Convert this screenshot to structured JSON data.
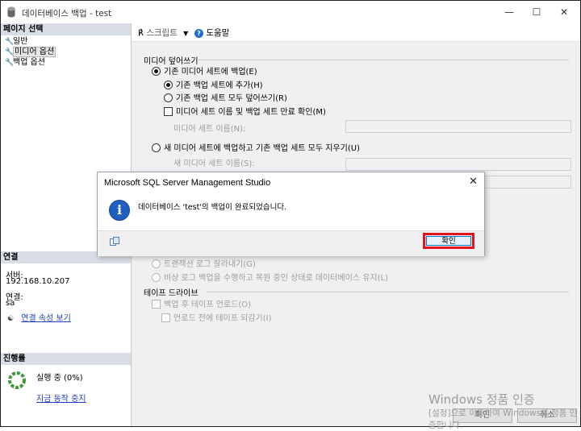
{
  "window": {
    "title": "데이터베이스 백업 - test"
  },
  "left": {
    "select_page_header": "페이지 선택",
    "pages": [
      {
        "label": "일반",
        "icon": "wrench-icon"
      },
      {
        "label": "미디어 옵션",
        "icon": "wrench-icon"
      },
      {
        "label": "백업 옵션",
        "icon": "wrench-icon"
      }
    ],
    "connection_header": "연결",
    "server_label": "서버:",
    "server_value": "192.168.10.207",
    "connection_label": "연결:",
    "connection_value": "sa",
    "view_connection_props": "연결 속성 보기",
    "progress_header": "진행률",
    "progress_status": "실행 중 (0%)",
    "stop_action": "지금 동작 중지"
  },
  "toolbar": {
    "script": "스크립트",
    "help": "도움말"
  },
  "media": {
    "overwrite_group": "미디어 덮어쓰기",
    "backup_existing": "기존 미디어 세트에 백업(E)",
    "append": "기존 백업 세트에 추가(H)",
    "overwrite_all": "기존 백업 세트 모두 덮어쓰기(R)",
    "check_name": "미디어 세트 이름 및 백업 세트 만료 확인(M)",
    "media_set_name_label": "미디어 세트 이름(N):",
    "new_media": "새 미디어 세트에 백업하고 기존 백업 세트 모두 지우기(U)",
    "new_media_name_label": "새 미디어 세트 이름(S):",
    "truncate_log": "트랜잭션 로그 잘라내기(G)",
    "tail_log": "비상 로그 백업을 수행하고 복원 중인 상태로 데이터베이스 유지(L)",
    "tape_group": "테이프 드라이브",
    "unload_tape": "백업 후 테이프 언로드(O)",
    "rewind_tape": "언로드 전에 테이프 되감기(I)"
  },
  "bottom": {
    "ok": "확인",
    "cancel": "취소"
  },
  "watermark": {
    "line1": "Windows 정품 인증",
    "line2": "[설정]으로 이동하여 Windows를 정품 인증합니다."
  },
  "dialog": {
    "title": "Microsoft SQL Server Management Studio",
    "message": "데이터베이스 'test'의 백업이 완료되었습니다.",
    "ok": "확인"
  },
  "colors": {
    "highlight": "#e1131e",
    "info_icon": "#1f5fbf",
    "header_bg": "#d8dde6"
  }
}
